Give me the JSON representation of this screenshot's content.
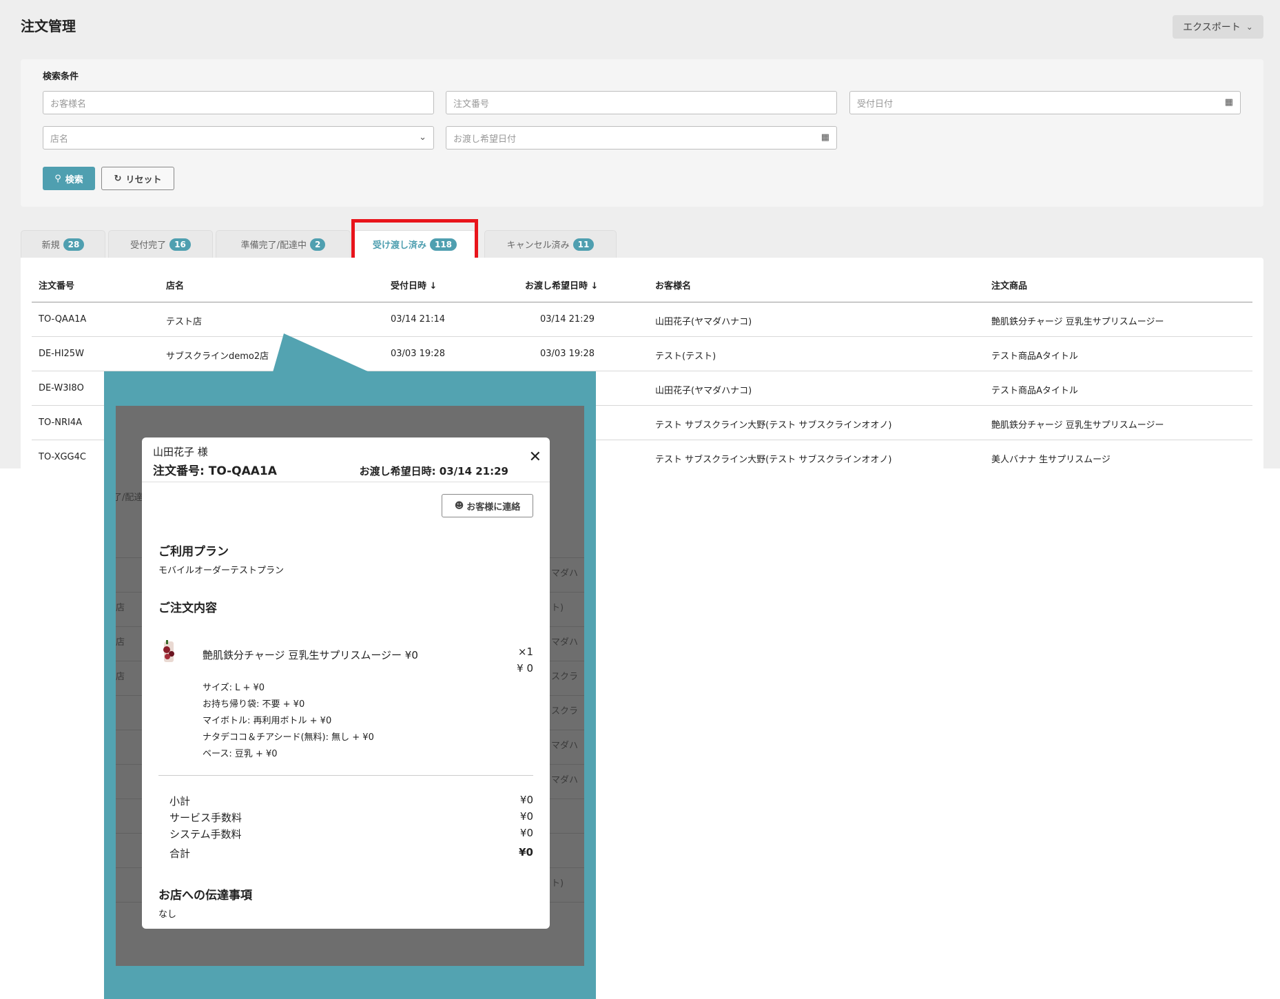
{
  "header": {
    "title": "注文管理",
    "export_label": "エクスポート"
  },
  "search": {
    "section_label": "検索条件",
    "customer_placeholder": "お客様名",
    "order_no_placeholder": "注文番号",
    "reception_date_placeholder": "受付日付",
    "store_placeholder": "店名",
    "handover_date_placeholder": "お渡し希望日付",
    "search_label": "検索",
    "reset_label": "リセット"
  },
  "tabs": [
    {
      "label": "新規",
      "count": "28"
    },
    {
      "label": "受付完了",
      "count": "16"
    },
    {
      "label": "準備完了/配達中",
      "count": "2"
    },
    {
      "label": "受け渡し済み",
      "count": "118"
    },
    {
      "label": "キャンセル済み",
      "count": "11"
    }
  ],
  "table": {
    "headers": [
      "注文番号",
      "店名",
      "受付日時 ↓",
      "お渡し希望日時 ↓",
      "お客様名",
      "注文商品"
    ],
    "rows": [
      [
        "TO-QAA1A",
        "テスト店",
        "03/14 21:14",
        "03/14 21:29",
        "山田花子(ヤマダハナコ)",
        "艶肌鉄分チャージ 豆乳生サプリスムージー"
      ],
      [
        "DE-HI25W",
        "サブスクラインdemo2店",
        "03/03 19:28",
        "03/03 19:28",
        "テスト(テスト)",
        "テスト商品Aタイトル"
      ],
      [
        "DE-W3I8O",
        "",
        "",
        "",
        "山田花子(ヤマダハナコ)",
        "テスト商品Aタイトル"
      ],
      [
        "TO-NRI4A",
        "",
        "",
        "",
        "テスト サブスクライン大野(テスト サブスクラインオオノ)",
        "艶肌鉄分チャージ 豆乳生サプリスムージー"
      ],
      [
        "TO-XGG4C",
        "",
        "",
        "",
        "テスト サブスクライン大野(テスト サブスクラインオオノ)",
        "美人バナナ 生サプリスムージ"
      ]
    ]
  },
  "background_fragments": [
    "了/配達",
    "マダハ",
    "ト)",
    "店",
    "マダハ",
    "店",
    "スクラ",
    "店",
    "スクラ",
    "マダハ",
    "マダハ",
    "ト)"
  ],
  "modal": {
    "customer": "山田花子 様",
    "order_no": "注文番号: TO-QAA1A",
    "delivery": "お渡し希望日時: 03/14 21:29",
    "contact_label": "お客様に連絡",
    "plan_heading": "ご利用プラン",
    "plan_name": "モバイルオーダーテストプラン",
    "order_heading": "ご注文内容",
    "item_name": "艶肌鉄分チャージ 豆乳生サプリスムージー ¥0",
    "item_qty": "×1",
    "item_price": "¥ 0",
    "options": [
      "サイズ: L + ¥0",
      "お持ち帰り袋: 不要 + ¥0",
      "マイボトル: 再利用ボトル + ¥0",
      "ナタデココ＆チアシード(無料): 無し + ¥0",
      "ベース: 豆乳 + ¥0"
    ],
    "summary": [
      {
        "label": "小計",
        "value": "¥0"
      },
      {
        "label": "サービス手数料",
        "value": "¥0"
      },
      {
        "label": "システム手数料",
        "value": "¥0"
      },
      {
        "label": "合計",
        "value": "¥0"
      }
    ],
    "notes_heading": "お店への伝達事項",
    "notes": "なし"
  },
  "colors": {
    "accent": "#4f9fb0",
    "callout": "#53a3b1",
    "highlight": "#e8141b"
  }
}
